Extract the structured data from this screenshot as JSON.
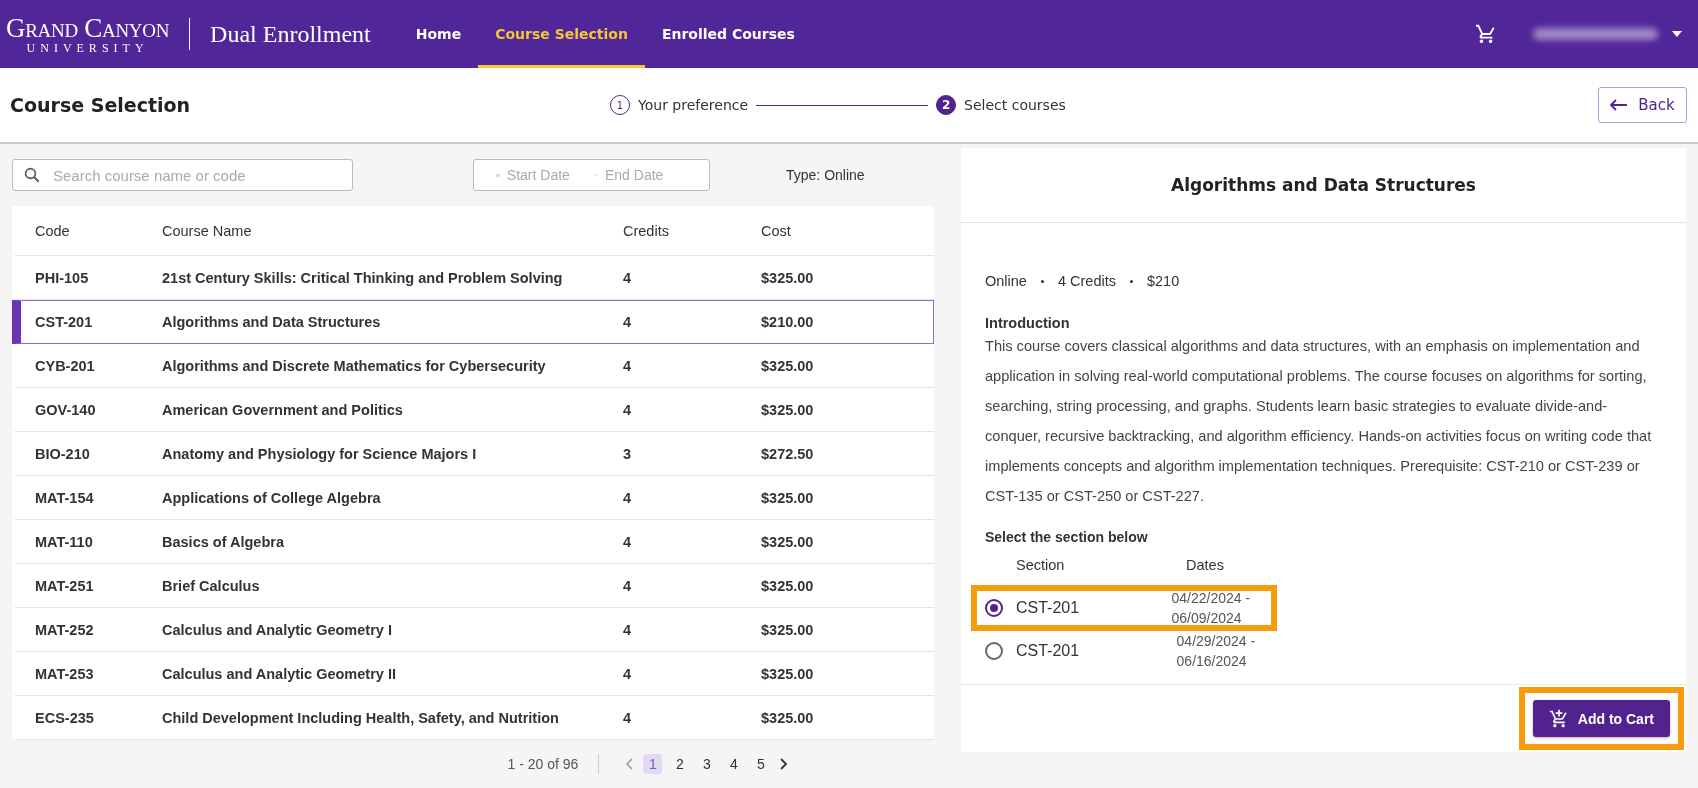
{
  "header": {
    "logo_main": "Grand Canyon",
    "logo_sub": "UNIVERSITY",
    "app_title": "Dual Enrollment",
    "nav": [
      {
        "label": "Home",
        "selected": false
      },
      {
        "label": "Course Selection",
        "selected": true
      },
      {
        "label": "Enrolled Courses",
        "selected": false
      }
    ]
  },
  "subheader": {
    "title": "Course Selection",
    "steps": [
      {
        "number": "1",
        "label": "Your preference",
        "current": false
      },
      {
        "number": "2",
        "label": "Select courses",
        "current": true
      }
    ],
    "back_button": "Back"
  },
  "filters": {
    "search_placeholder": "Search course name or code",
    "start_placeholder": "Start Date",
    "end_placeholder": "End Date",
    "type": "Type: Online"
  },
  "table": {
    "columns": [
      "Code",
      "Course Name",
      "Credits",
      "Cost"
    ],
    "rows": [
      {
        "code": "PHI-105",
        "name": "21st Century Skills: Critical Thinking and Problem Solving",
        "credits": "4",
        "cost": "$325.00",
        "selected": false
      },
      {
        "code": "CST-201",
        "name": "Algorithms and Data Structures",
        "credits": "4",
        "cost": "$210.00",
        "selected": true
      },
      {
        "code": "CYB-201",
        "name": "Algorithms and Discrete Mathematics for Cybersecurity",
        "credits": "4",
        "cost": "$325.00",
        "selected": false
      },
      {
        "code": "GOV-140",
        "name": "American Government and Politics",
        "credits": "4",
        "cost": "$325.00",
        "selected": false
      },
      {
        "code": "BIO-210",
        "name": "Anatomy and Physiology for Science Majors I",
        "credits": "3",
        "cost": "$272.50",
        "selected": false
      },
      {
        "code": "MAT-154",
        "name": "Applications of College Algebra",
        "credits": "4",
        "cost": "$325.00",
        "selected": false
      },
      {
        "code": "MAT-110",
        "name": "Basics of Algebra",
        "credits": "4",
        "cost": "$325.00",
        "selected": false
      },
      {
        "code": "MAT-251",
        "name": "Brief Calculus",
        "credits": "4",
        "cost": "$325.00",
        "selected": false
      },
      {
        "code": "MAT-252",
        "name": "Calculus and Analytic Geometry I",
        "credits": "4",
        "cost": "$325.00",
        "selected": false
      },
      {
        "code": "MAT-253",
        "name": "Calculus and Analytic Geometry II",
        "credits": "4",
        "cost": "$325.00",
        "selected": false
      },
      {
        "code": "ECS-235",
        "name": "Child Development Including Health, Safety, and Nutrition",
        "credits": "4",
        "cost": "$325.00",
        "selected": false
      }
    ]
  },
  "pagination": {
    "range": "1 - 20 of 96",
    "pages": [
      {
        "label": "1",
        "selected": true
      },
      {
        "label": "2",
        "selected": false
      },
      {
        "label": "3",
        "selected": false
      },
      {
        "label": "4",
        "selected": false
      },
      {
        "label": "5",
        "selected": false
      }
    ]
  },
  "detail": {
    "title": "Algorithms and Data Structures",
    "meta": [
      "Online",
      "4 Credits",
      "$210"
    ],
    "intro_heading": "Introduction",
    "intro_text": "This course covers classical algorithms and data structures, with an emphasis on implementation and application in solving real-world computational problems. The course focuses on algorithms for sorting, searching, string processing, and graphs. Students learn basic strategies to evaluate divide-and-conquer, recursive backtracking, and algorithm efficiency. Hands-on activities focus on writing code that implements concepts and algorithm implementation techniques. Prerequisite: CST-210 or CST-239 or CST-135 or CST-250 or CST-227.",
    "section_heading": "Select the section below",
    "section_columns": [
      "Section",
      "Dates"
    ],
    "sections": [
      {
        "name": "CST-201",
        "dates": "04/22/2024 - 06/09/2024",
        "selected": true,
        "highlighted": true
      },
      {
        "name": "CST-201",
        "dates": "04/29/2024 - 06/16/2024",
        "selected": false,
        "highlighted": false
      }
    ],
    "add_button": {
      "label": "Add to Cart",
      "highlighted": true
    }
  }
}
